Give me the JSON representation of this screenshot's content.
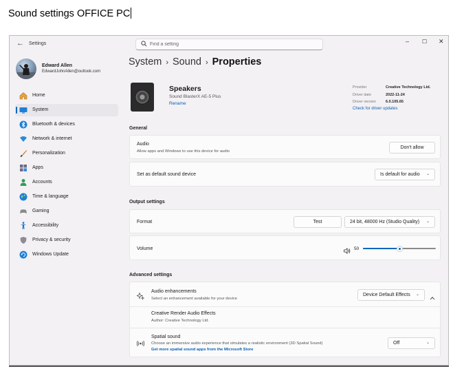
{
  "document": {
    "title": "Sound settings OFFICE PC"
  },
  "window": {
    "app_title": "Settings",
    "controls": {
      "minimize": "–",
      "maximize": "☐",
      "close": "✕"
    }
  },
  "search": {
    "placeholder": "Find a setting"
  },
  "profile": {
    "name": "Edward Allen",
    "email": "EdwardJohnAllen@outlook.com"
  },
  "nav": {
    "items": [
      {
        "label": "Home",
        "icon": "home-icon"
      },
      {
        "label": "System",
        "icon": "system-icon",
        "selected": true
      },
      {
        "label": "Bluetooth & devices",
        "icon": "bluetooth-icon"
      },
      {
        "label": "Network & internet",
        "icon": "network-icon"
      },
      {
        "label": "Personalization",
        "icon": "brush-icon"
      },
      {
        "label": "Apps",
        "icon": "apps-icon"
      },
      {
        "label": "Accounts",
        "icon": "accounts-icon"
      },
      {
        "label": "Time & language",
        "icon": "globe-icon"
      },
      {
        "label": "Gaming",
        "icon": "gamepad-icon"
      },
      {
        "label": "Accessibility",
        "icon": "accessibility-icon"
      },
      {
        "label": "Privacy & security",
        "icon": "shield-icon"
      },
      {
        "label": "Windows Update",
        "icon": "update-icon"
      }
    ]
  },
  "breadcrumb": {
    "level1": "System",
    "level2": "Sound",
    "current": "Properties",
    "separator": "›"
  },
  "device": {
    "name": "Speakers",
    "model": "Sound BlasterX AE-5 Plus",
    "rename": "Rename",
    "provider_label": "Provider",
    "provider_value": "Creative Technology Ltd.",
    "driver_date_label": "Driver date",
    "driver_date_value": "2022-11-24",
    "driver_version_label": "Driver version",
    "driver_version_value": "6.0.105.65",
    "check_updates": "Check for driver updates"
  },
  "general": {
    "title": "General",
    "audio": {
      "title": "Audio",
      "subtitle": "Allow apps and Windows to use this device for audio",
      "button": "Don't allow"
    },
    "default_device": {
      "title": "Set as default sound device",
      "value": "Is default for audio"
    }
  },
  "output": {
    "title": "Output settings",
    "format": {
      "title": "Format",
      "test": "Test",
      "value": "24 bit, 48000 Hz (Studio Quality)"
    },
    "volume": {
      "title": "Volume",
      "value": "50",
      "level": 0.5
    }
  },
  "advanced": {
    "title": "Advanced settings",
    "enhancements": {
      "title": "Audio enhancements",
      "subtitle": "Select an enhancement available for your device",
      "value": "Device Default Effects"
    },
    "creative": {
      "title": "Creative Render Audio Effects",
      "subtitle": "Author: Creative Technology Ltd."
    },
    "spatial": {
      "title": "Spatial sound",
      "subtitle": "Choose an immersive audio experience that simulates a realistic environment (3D Spatial Sound)",
      "link": "Get more spatial sound apps from the Microsoft Store",
      "value": "Off"
    }
  },
  "colors": {
    "accent": "#0067c0",
    "link": "#0a5fb4"
  }
}
